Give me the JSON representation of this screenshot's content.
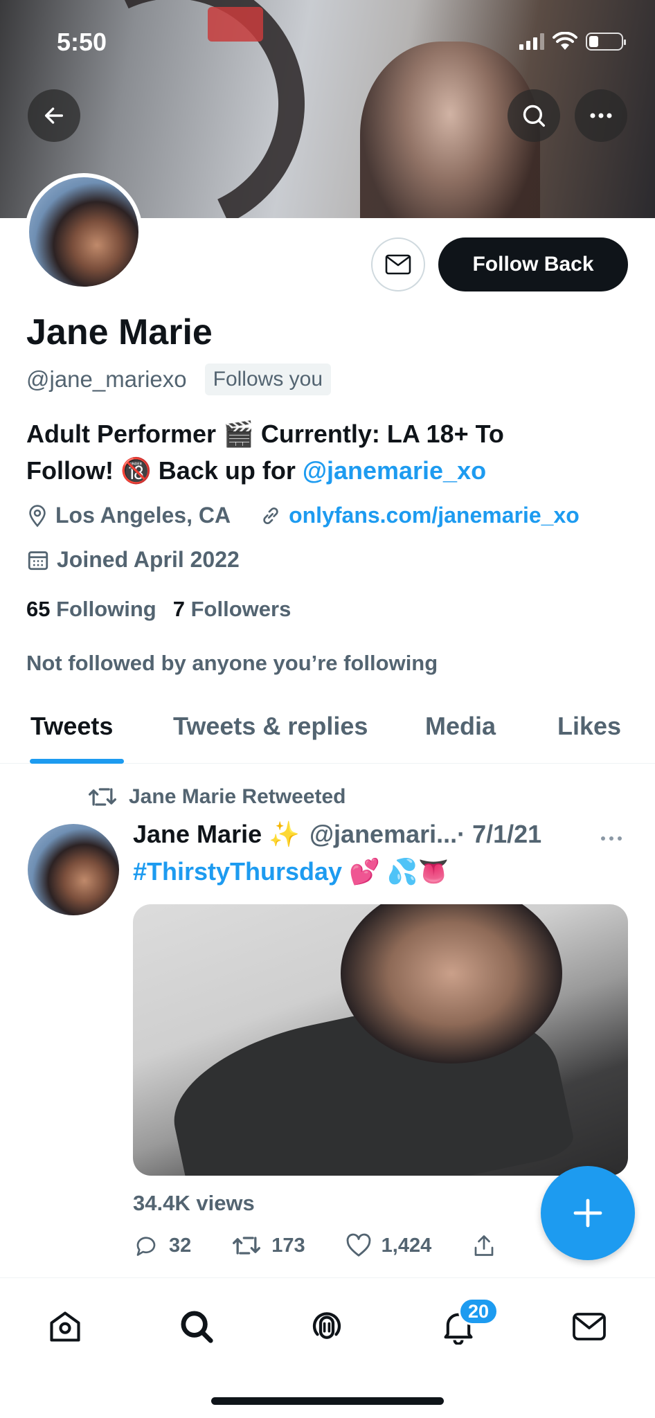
{
  "status_bar": {
    "time": "5:50"
  },
  "profile": {
    "name": "Jane Marie",
    "handle": "@jane_mariexo",
    "follows_you": "Follows you",
    "follow_button": "Follow Back",
    "bio_line1": "Adult Performer 🎬 Currently: LA 18+ To",
    "bio_line2_prefix": "Follow! 🔞 Back up for ",
    "bio_link": "@janemarie_xo",
    "location": "Los Angeles, CA",
    "website": "onlyfans.com/janemarie_xo",
    "joined": "Joined April 2022",
    "following_count": "65",
    "following_label": "Following",
    "followers_count": "7",
    "followers_label": "Followers",
    "not_followed": "Not followed by anyone you’re following"
  },
  "tabs": [
    {
      "label": "Tweets",
      "active": true
    },
    {
      "label": "Tweets & replies",
      "active": false
    },
    {
      "label": "Media",
      "active": false
    },
    {
      "label": "Likes",
      "active": false
    }
  ],
  "tweet": {
    "retweet_label": "Jane Marie Retweeted",
    "author_name": "Jane Marie ✨",
    "author_handle": "@janemari...",
    "date": "· 7/1/21",
    "text": "#ThirstyThursday 💕 💦👅",
    "views": "34.4K views",
    "replies": "32",
    "retweets": "173",
    "likes": "1,424"
  },
  "nav": {
    "notifications_badge": "20"
  },
  "colors": {
    "accent": "#1d9bf0",
    "text": "#0f1419",
    "secondary": "#536471"
  }
}
